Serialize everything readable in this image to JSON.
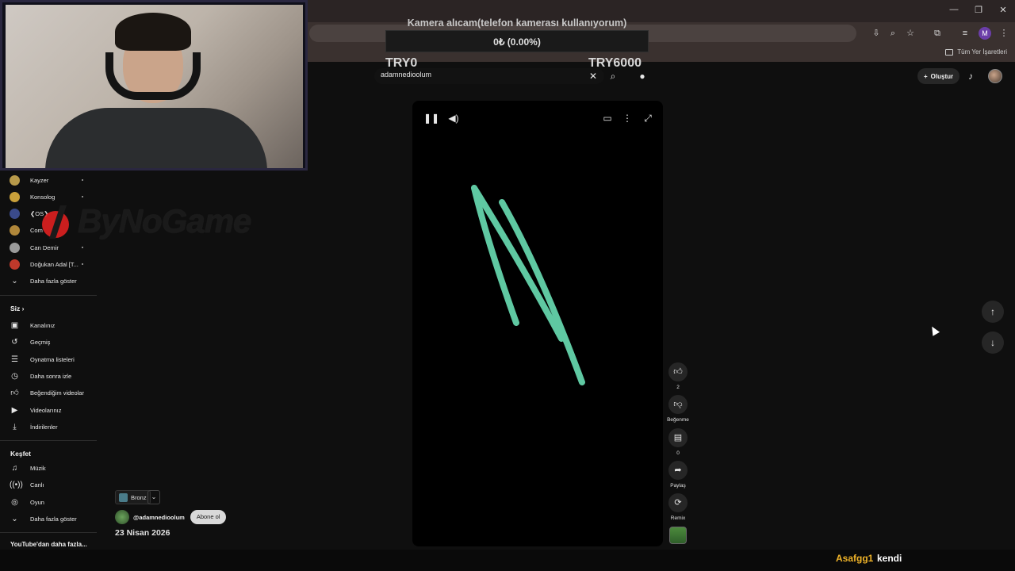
{
  "browser": {
    "window_controls": [
      "—",
      "❐",
      "✕"
    ],
    "bookmarks_all_label": "Tüm Yer İşaretleri",
    "profile_initial": "M"
  },
  "donation": {
    "title": "Kamera alıcam(telefon kamerası kullanıyorum)",
    "progress_text": "0₺ (0.00%)",
    "progress_fraction": 0.0,
    "min_label": "TRY0",
    "max_label": "TRY6000",
    "fill_color": "#2f7a3a"
  },
  "header": {
    "search_value": "adamnedioolum",
    "create_label": "Oluştur"
  },
  "sidebar": {
    "channels": [
      {
        "label": "Kayzer",
        "color": "#b89a4a"
      },
      {
        "label": "Konsolog",
        "color": "#c9a03a"
      },
      {
        "label": "❮OS❯",
        "color": "#3a4a8a"
      },
      {
        "label": "Com",
        "color": "#b0873a"
      },
      {
        "label": "Can Demir",
        "color": "#9a9a9a"
      },
      {
        "label": "Doğukan Adal [T...",
        "color": "#c0392b"
      }
    ],
    "channels_more": "Daha fazla göster",
    "you_heading": "Siz",
    "you_items": [
      {
        "label": "Kanalınız",
        "icon": "channel-icon"
      },
      {
        "label": "Geçmiş",
        "icon": "history-icon"
      },
      {
        "label": "Oynatma listeleri",
        "icon": "playlists-icon"
      },
      {
        "label": "Daha sonra izle",
        "icon": "watch-later-icon"
      },
      {
        "label": "Beğendiğim videolar",
        "icon": "liked-icon"
      },
      {
        "label": "Videolarınız",
        "icon": "your-videos-icon"
      },
      {
        "label": "İndirilenler",
        "icon": "downloads-icon"
      }
    ],
    "explore_heading": "Keşfet",
    "explore_items": [
      {
        "label": "Müzik",
        "icon": "music-icon"
      },
      {
        "label": "Canlı",
        "icon": "live-icon"
      },
      {
        "label": "Oyun",
        "icon": "gaming-icon"
      }
    ],
    "explore_more": "Daha fazla göster",
    "more_from_youtube": "YouTube'dan daha fazla..."
  },
  "watermark": {
    "text": "ByNoGame"
  },
  "actions": {
    "like_count": "2",
    "dislike_label": "Beğenme",
    "comment_count": "0",
    "share_label": "Paylaş",
    "remix_label": "Remix"
  },
  "channel": {
    "rank_label": "Bronz",
    "handle": "@adamnedioolum",
    "subscribe_label": "Abone ol",
    "date": "23 Nisan 2026"
  },
  "chat": {
    "user": "Asafgg1",
    "message": "kendi"
  }
}
